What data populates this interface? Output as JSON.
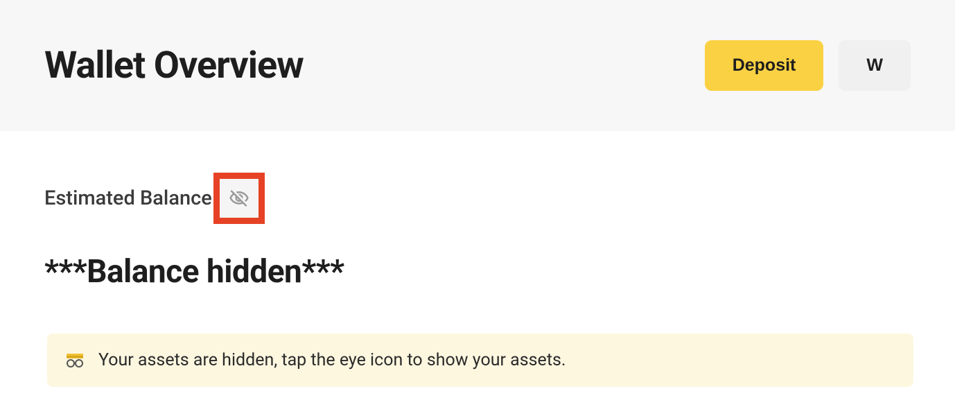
{
  "header": {
    "title": "Wallet Overview",
    "deposit_label": "Deposit",
    "secondary_label": "W"
  },
  "balance": {
    "label": "Estimated Balance",
    "value": "***Balance hidden***"
  },
  "notice": {
    "text": "Your assets are hidden, tap the eye icon to show your assets."
  }
}
